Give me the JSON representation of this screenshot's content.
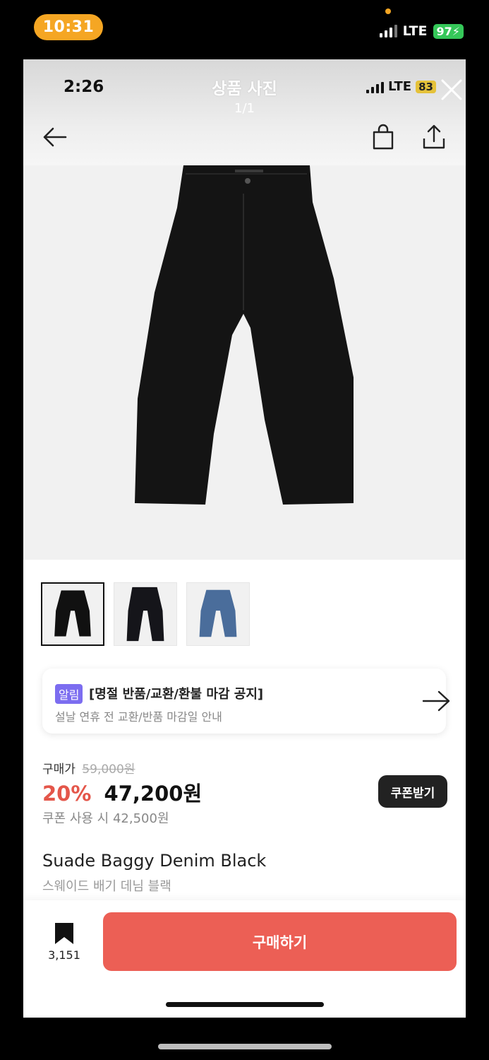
{
  "device": {
    "time": "10:31",
    "network": "LTE",
    "battery": "97"
  },
  "inner_status": {
    "time": "2:26",
    "network": "LTE",
    "battery": "83"
  },
  "header": {
    "title": "상품 사진",
    "counter": "1/1"
  },
  "thumbnails": [
    {
      "color": "#111111",
      "selected": true
    },
    {
      "color": "#15151a",
      "selected": false
    },
    {
      "color": "#4a6d9b",
      "selected": false
    }
  ],
  "notice": {
    "badge": "알림",
    "title": "[명절 반품/교환/환불 마감 공지]",
    "subtitle": "설날 연휴 전 교환/반품 마감일 안내"
  },
  "price": {
    "label": "구매가",
    "original": "59,000원",
    "discount": "20%",
    "current": "47,200원",
    "coupon_price": "쿠폰 사용 시 42,500원",
    "coupon_button": "쿠폰받기"
  },
  "product": {
    "name_en": "Suade Baggy Denim Black",
    "name_ko": "스웨이드 배기 데님 블랙"
  },
  "bottom": {
    "wish_count": "3,151",
    "buy_label": "구매하기"
  },
  "colors": {
    "accent": "#ec5f55",
    "discount": "#e4564a",
    "badge": "#7c6df0"
  }
}
